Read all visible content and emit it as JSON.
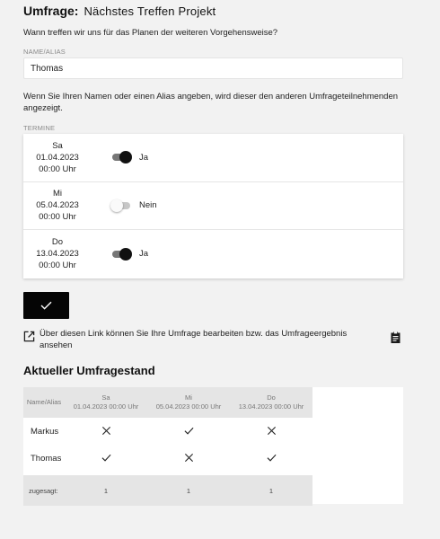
{
  "header": {
    "prefix": "Umfrage:",
    "title": "Nächstes Treffen Projekt"
  },
  "question": "Wann treffen wir uns für das Planen der weiteren Vorgehensweise?",
  "name_field": {
    "label": "NAME/ALIAS",
    "value": "Thomas"
  },
  "hint": "Wenn Sie Ihren Namen oder einen Alias angeben, wird dieser den anderen Umfrageteilnehmenden angezeigt.",
  "dates_label": "TERMINE",
  "dates": [
    {
      "day": "Sa",
      "date": "01.04.2023",
      "time": "00:00 Uhr",
      "selected": true,
      "answer": "Ja"
    },
    {
      "day": "Mi",
      "date": "05.04.2023",
      "time": "00:00 Uhr",
      "selected": false,
      "answer": "Nein"
    },
    {
      "day": "Do",
      "date": "13.04.2023",
      "time": "00:00 Uhr",
      "selected": true,
      "answer": "Ja"
    }
  ],
  "submit": {
    "icon": "check-icon"
  },
  "edit_link": {
    "text": "Über diesen Link können Sie Ihre Umfrage bearbeiten bzw. das Umfrageergebnis ansehen",
    "icon": "open-in-new-icon",
    "copy_icon": "clipboard-icon"
  },
  "results": {
    "title": "Aktueller Umfragestand",
    "name_header": "Name/Alias",
    "columns": [
      {
        "day": "Sa",
        "datetime": "01.04.2023 00:00 Uhr"
      },
      {
        "day": "Mi",
        "datetime": "05.04.2023 00:00 Uhr"
      },
      {
        "day": "Do",
        "datetime": "13.04.2023 00:00 Uhr"
      }
    ],
    "rows": [
      {
        "name": "Markus",
        "votes": [
          false,
          true,
          false
        ]
      },
      {
        "name": "Thomas",
        "votes": [
          true,
          false,
          true
        ]
      }
    ],
    "sum_label": "zugesagt:",
    "sums": [
      "1",
      "1",
      "1"
    ]
  },
  "colors": {
    "background": "#f2f2f2",
    "button": "#050505",
    "toggle_on": "#111111",
    "header_row": "#e5e5e5"
  }
}
